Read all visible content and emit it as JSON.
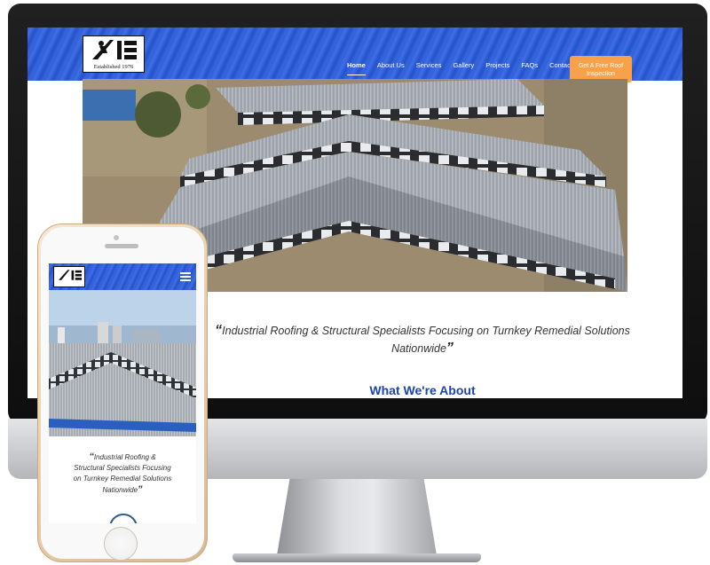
{
  "desktop": {
    "logo": {
      "tagline": "Established 1976"
    },
    "nav": {
      "items": [
        {
          "label": "Home"
        },
        {
          "label": "About Us"
        },
        {
          "label": "Services"
        },
        {
          "label": "Gallery"
        },
        {
          "label": "Projects"
        },
        {
          "label": "FAQs"
        },
        {
          "label": "Contact"
        }
      ],
      "cta_line1": "Get A Free Roof",
      "cta_line2": "Inspection"
    },
    "tagline": {
      "open_quote": "“",
      "text_line1": "Industrial Roofing & Structural Specialists Focusing on Turnkey Remedial Solutions",
      "text_line2": "Nationwide",
      "close_quote": "”"
    },
    "section_title": "What We're About"
  },
  "mobile": {
    "tagline": {
      "open_quote": "“",
      "line1": "Industrial Roofing &",
      "line2": "Structural Specialists Focusing",
      "line3": "on Turnkey Remedial Solutions",
      "line4": "Nationwide",
      "close_quote": "”"
    }
  },
  "colors": {
    "header_blue": "#2f5fd8",
    "cta_orange": "#f7a24a",
    "title_blue": "#1b44b0"
  },
  "icons": [
    "logo-roofer-icon",
    "hamburger-menu-icon"
  ]
}
